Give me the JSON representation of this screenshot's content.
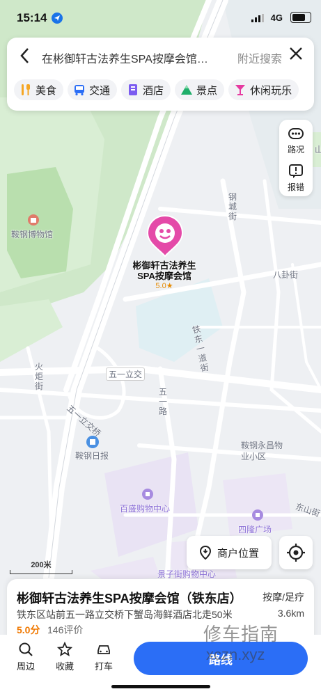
{
  "status_bar": {
    "time": "15:14",
    "network": "4G"
  },
  "search": {
    "query": "在彬御轩古法养生SPA按摩会馆附近搜索",
    "query_display": "在彬御轩古法养生SPA按摩会馆…",
    "nearby_label": "附近搜索",
    "categories": [
      {
        "label": "美食",
        "icon": "fork-knife-icon",
        "color": "#f5a623"
      },
      {
        "label": "交通",
        "icon": "bus-icon",
        "color": "#2b6ef6"
      },
      {
        "label": "酒店",
        "icon": "hotel-icon",
        "color": "#7b5cf0"
      },
      {
        "label": "景点",
        "icon": "mountain-icon",
        "color": "#1fae6a"
      },
      {
        "label": "休闲玩乐",
        "icon": "cocktail-icon",
        "color": "#e63aa0"
      }
    ]
  },
  "map_controls": {
    "traffic_label": "路况",
    "report_label": "报错"
  },
  "poi": {
    "name_line1": "彬御轩古法养生",
    "name_line2": "SPA按摩会馆",
    "rating": "5.0★",
    "pin_color": "#e44aa8"
  },
  "map_labels": {
    "museum": "鞍钢博物馆",
    "gangcheng_st": "钢城街",
    "bagua_st": "八卦街",
    "tiedong_yidao_st": "铁东一道街",
    "wuyi_lijiao": "五一立交",
    "wuyi_lijiaoqiao": "五一立交桥",
    "wuyi_rd": "五一路",
    "huoju_st": "火炬街",
    "angang_daily": "鞍钢日报",
    "yongchang": "鞍钢永昌物业小区",
    "baisheng": "百盛购物中心",
    "silong": "四隆广场",
    "dongshan_st": "东山街",
    "jingzijie": "景子街购物中心",
    "shan_edge": "山"
  },
  "scale": "200米",
  "merchant_location_label": "商户位置",
  "place": {
    "name": "彬御轩古法养生SPA按摩会馆（铁东店）",
    "category": "按摩/足疗",
    "address": "铁东区站前五一路立交桥下蟹岛海鲜酒店北走50米",
    "distance": "3.6km",
    "score": "5.0分",
    "reviews": "146评价"
  },
  "bottom_bar": {
    "nearby": "周边",
    "favorite": "收藏",
    "taxi": "打车",
    "route": "路线"
  },
  "watermark": {
    "line1": "修车指南",
    "line2": "xczn.xyz"
  },
  "colors": {
    "accent": "#2b6ef6",
    "poi": "#e44aa8",
    "score": "#f07800",
    "green_area": "#cde8c9",
    "road": "#ffffff"
  }
}
